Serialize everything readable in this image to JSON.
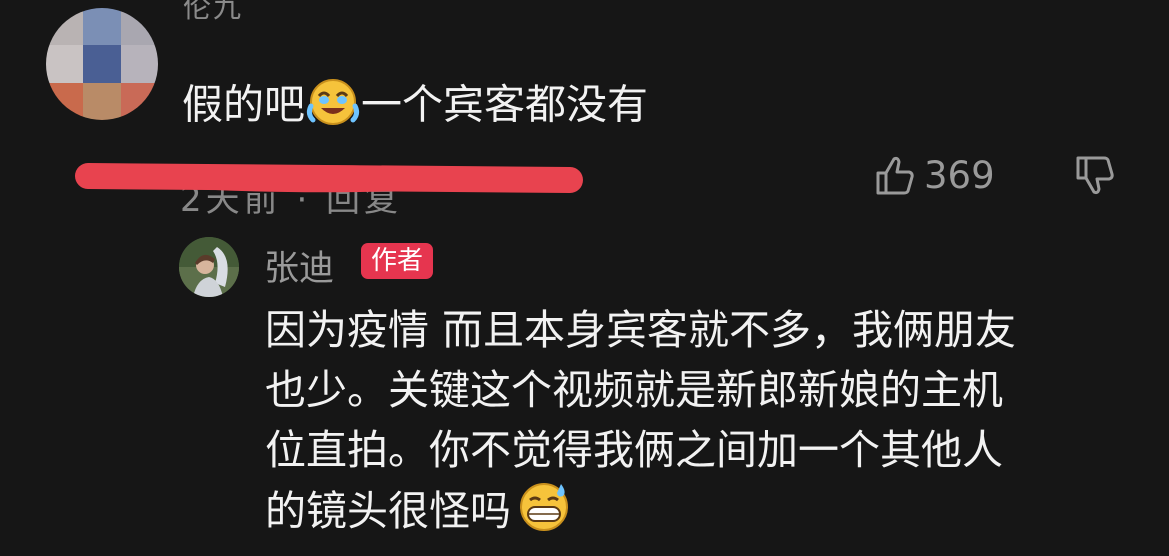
{
  "comment": {
    "username": "伦九",
    "text_before_emoji": "假的吧",
    "emoji": "crying-laughing-emoji",
    "text_after_emoji": "一个宾客都没有",
    "meta": "2天前 · 回复",
    "likes": "369"
  },
  "reply": {
    "username": "张迪",
    "badge": "作者",
    "lines": [
      "因为疫情 而且本身宾客就不多，我俩朋友",
      "也少。关键这个视频就是新郎新娘的主机",
      "位直拍。你不觉得我俩之间加一个其他人",
      "的镜头很怪吗"
    ],
    "emoji": "grinning-sweat-emoji"
  },
  "colors": {
    "background": "#161616",
    "badge": "#e6354f",
    "scribble": "#e8434f"
  }
}
